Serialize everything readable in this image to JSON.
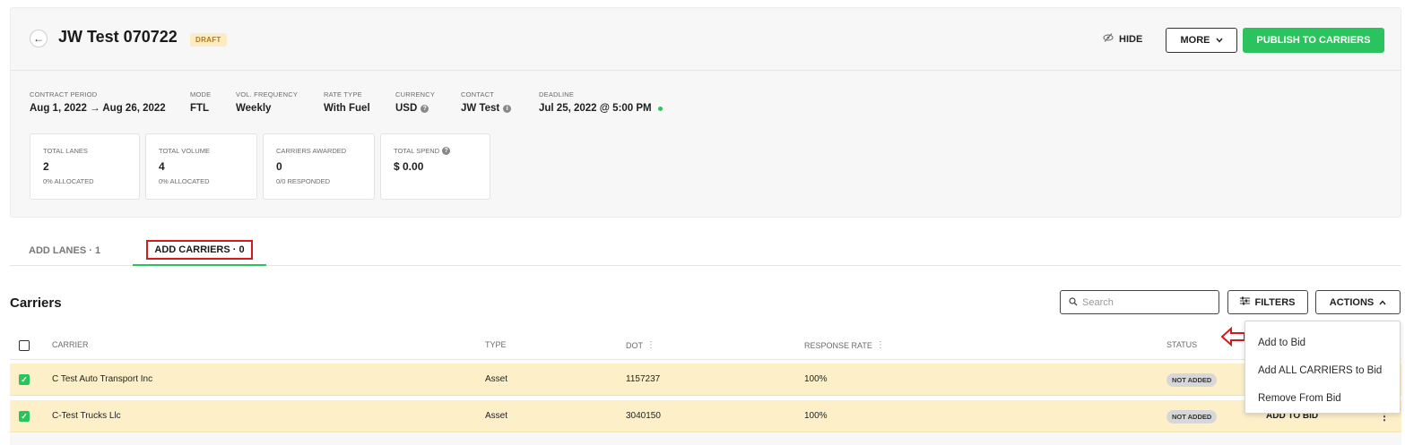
{
  "header": {
    "back_icon": "arrow-left-icon",
    "title": "JW Test 070722",
    "status_badge": "DRAFT",
    "hide_label": "HIDE",
    "more_label": "MORE",
    "publish_label": "PUBLISH TO CARRIERS",
    "accent_color": "#2bc35e"
  },
  "meta": {
    "contract_period": {
      "label": "CONTRACT PERIOD",
      "value": "Aug 1, 2022 → Aug 26, 2022"
    },
    "mode": {
      "label": "MODE",
      "value": "FTL"
    },
    "vol_frequency": {
      "label": "VOL. FREQUENCY",
      "value": "Weekly"
    },
    "rate_type": {
      "label": "RATE TYPE",
      "value": "With Fuel"
    },
    "currency": {
      "label": "CURRENCY",
      "value": "USD"
    },
    "contact": {
      "label": "CONTACT",
      "value": "JW Test"
    },
    "deadline": {
      "label": "DEADLINE",
      "value": "Jul 25, 2022 @ 5:00 PM"
    }
  },
  "stats": [
    {
      "label": "TOTAL LANES",
      "value": "2",
      "sub": "0% ALLOCATED"
    },
    {
      "label": "TOTAL VOLUME",
      "value": "4",
      "sub": "0% ALLOCATED"
    },
    {
      "label": "CARRIERS AWARDED",
      "value": "0",
      "sub": "0/0 RESPONDED"
    },
    {
      "label": "TOTAL SPEND",
      "value": "$ 0.00",
      "sub": ""
    }
  ],
  "tabs": [
    {
      "label": "ADD LANES · 1"
    },
    {
      "label": "ADD CARRIERS · 0"
    }
  ],
  "carriers": {
    "title": "Carriers",
    "search_placeholder": "Search",
    "filters_label": "FILTERS",
    "actions_label": "ACTIONS",
    "columns": [
      "CARRIER",
      "TYPE",
      "DOT",
      "RESPONSE RATE",
      "STATUS"
    ],
    "rows": [
      {
        "carrier": "C Test Auto Transport Inc",
        "type": "Asset",
        "dot": "1157237",
        "response_rate": "100%",
        "status": "NOT ADDED",
        "action": ""
      },
      {
        "carrier": "C-Test Trucks Llc",
        "type": "Asset",
        "dot": "3040150",
        "response_rate": "100%",
        "status": "NOT ADDED",
        "action": "ADD TO BID"
      }
    ]
  },
  "actions_menu": {
    "items": [
      "Add to Bid",
      "Add ALL CARRIERS to Bid",
      "Remove From Bid"
    ]
  }
}
